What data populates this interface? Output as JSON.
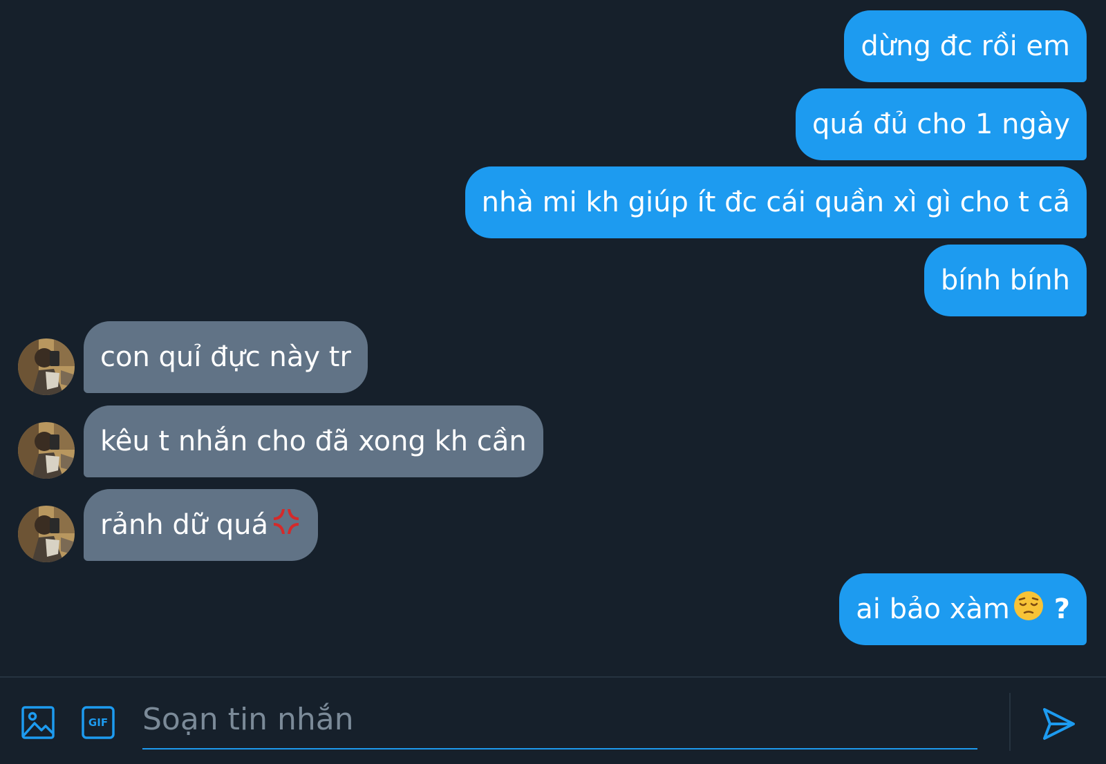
{
  "colors": {
    "background": "#16202b",
    "sent_bubble": "#1d9bf0",
    "received_bubble": "#617386",
    "accent": "#1d9bf0",
    "placeholder": "#7b8a98"
  },
  "messages": [
    {
      "direction": "sent",
      "text": "dừng đc rồi em"
    },
    {
      "direction": "sent",
      "text": "quá đủ cho 1 ngày"
    },
    {
      "direction": "sent",
      "text": "nhà mi kh giúp ít đc cái quần xì gì cho t cả"
    },
    {
      "direction": "sent",
      "text": "bính bính"
    },
    {
      "direction": "received",
      "text": "con quỉ đực này tr"
    },
    {
      "direction": "received",
      "text": "kêu t nhắn cho đã xong kh cần"
    },
    {
      "direction": "received",
      "text": "rảnh dữ quá",
      "emoji": "anger-symbol-emoji"
    },
    {
      "direction": "sent",
      "text": "ai bảo xàm",
      "emoji": "pensive-face-emoji",
      "suffix": " ?"
    }
  ],
  "composer": {
    "placeholder": "Soạn tin nhắn",
    "value": "",
    "media_icon": "image-icon",
    "gif_icon": "gif-icon",
    "gif_label": "GIF",
    "send_icon": "send-icon"
  }
}
